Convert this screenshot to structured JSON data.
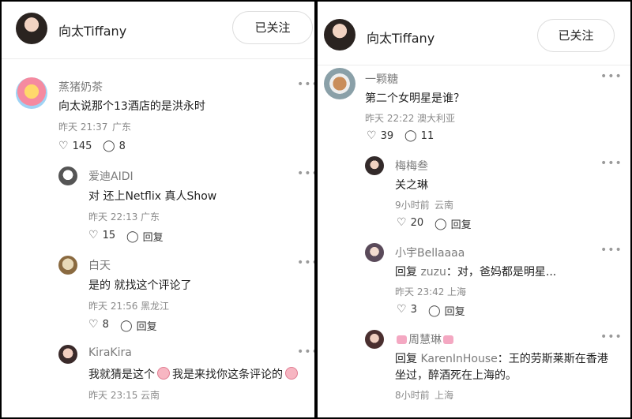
{
  "left": {
    "header": {
      "name": "向太Tiffany",
      "follow_label": "已关注"
    },
    "comments": [
      {
        "user": "蒸猪奶茶",
        "text": "向太说那个13酒店的是洪永时",
        "time": "昨天 21:37",
        "loc": "广东",
        "likes": "145",
        "replies": "8"
      },
      {
        "user": "爱迪AIDI",
        "text": "对 还上Netflix 真人Show",
        "time": "昨天 22:13",
        "loc": "广东",
        "likes": "15",
        "reply_label": "回复"
      },
      {
        "user": "白天",
        "text": "是的 就找这个评论了",
        "time": "昨天 21:56",
        "loc": "黑龙江",
        "likes": "8",
        "reply_label": "回复"
      },
      {
        "user": "KiraKira",
        "text_a": "我就猜是这个",
        "text_b": "我是来找你这条评论的",
        "time": "昨天 23:15",
        "loc": "云南"
      }
    ]
  },
  "right": {
    "header": {
      "name": "向太Tiffany",
      "follow_label": "已关注"
    },
    "comments": [
      {
        "user": "一颗糖",
        "text": "第二个女明星是谁？",
        "time": "昨天 22:22",
        "loc": "澳大利亚",
        "likes": "39",
        "replies": "11"
      },
      {
        "user": "梅梅叁",
        "text": "关之琳",
        "time": "9小时前",
        "loc": "云南",
        "likes": "20",
        "reply_label": "回复"
      },
      {
        "user": "小宇Bellaaaa",
        "reply_word": "回复",
        "reply_target": "zuzu",
        "text": "：对，爸妈都是明星...",
        "time": "昨天 23:42",
        "loc": "上海",
        "likes": "3",
        "reply_label": "回复"
      },
      {
        "user": "周慧琳",
        "reply_word": "回复",
        "reply_target": "KarenInHouse",
        "text_line1": "：王的劳斯莱斯在香港",
        "text_line2": "坐过，醉酒死在上海的。",
        "time": "8小时前",
        "loc": "上海"
      }
    ]
  },
  "icons": {
    "heart": "heart-icon",
    "comment": "comment-icon",
    "more": "more-icon"
  }
}
